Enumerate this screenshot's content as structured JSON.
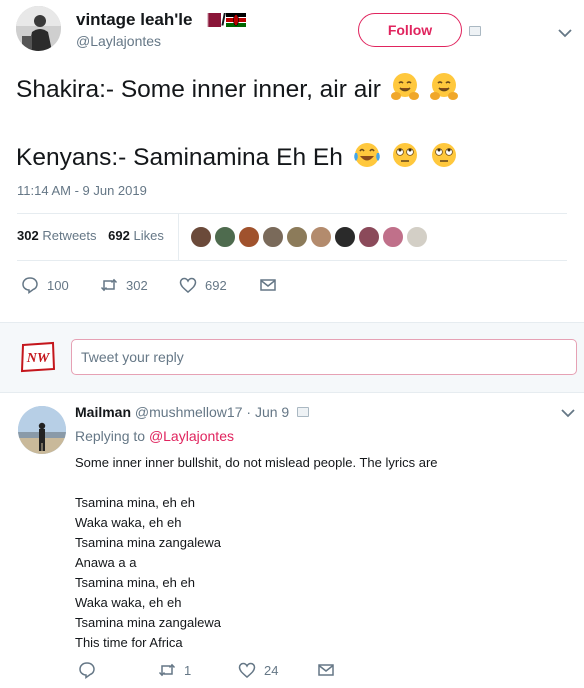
{
  "tweet": {
    "author_name": "vintage leah'le",
    "author_name_suffix": "/",
    "handle": "@Laylajontes",
    "follow_label": "Follow",
    "line1": "Shakira:- Some inner inner, air air",
    "line2": "Kenyans:- Saminamina Eh Eh",
    "timestamp": "11:14 AM - 9 Jun 2019",
    "retweets_count": "302",
    "retweets_label": "Retweets",
    "likes_count": "692",
    "likes_label": "Likes",
    "actions": {
      "reply_count": "100",
      "retweet_count": "302",
      "like_count": "692"
    }
  },
  "reply_box": {
    "logo_text": "NW",
    "placeholder": "Tweet your reply"
  },
  "reply": {
    "name": "Mailman",
    "handle": "@mushmellow17",
    "date": "· Jun 9",
    "replying_prefix": "Replying to",
    "replying_to": "@Laylajontes",
    "lines": [
      "Some inner inner bullshit, do not mislead people. The lyrics are",
      "",
      "Tsamina mina, eh eh",
      "Waka waka, eh eh",
      "Tsamina mina zangalewa",
      "Anawa a a",
      "Tsamina mina, eh eh",
      "Waka waka, eh eh",
      "Tsamina mina zangalewa",
      "This time for Africa"
    ],
    "actions": {
      "retweet_count": "1",
      "like_count": "24"
    }
  },
  "colors": {
    "accent": "#e0245e",
    "muted": "#657786",
    "text": "#14171a",
    "border": "#e6ecf0"
  },
  "icons": [
    "qatar-flag-icon",
    "kenya-flag-icon",
    "hugging-face-icon",
    "tears-of-joy-icon",
    "eye-roll-icon",
    "reply-icon",
    "retweet-icon",
    "heart-icon",
    "message-icon",
    "chevron-down-icon"
  ]
}
